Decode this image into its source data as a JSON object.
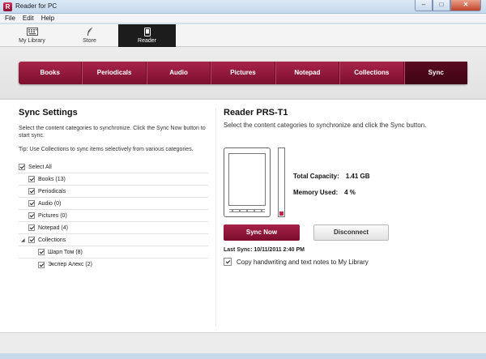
{
  "window": {
    "title": "Reader for PC",
    "icon_letter": "R",
    "controls": [
      "min",
      "max",
      "close"
    ]
  },
  "menu": [
    "File",
    "Edit",
    "Help"
  ],
  "top_tabs": [
    {
      "label": "My Library",
      "icon": "library-keyboard-icon"
    },
    {
      "label": "Store",
      "icon": "store-feather-icon"
    },
    {
      "label": "Reader",
      "icon": "reader-device-icon",
      "active": true
    }
  ],
  "categories": [
    {
      "label": "Books"
    },
    {
      "label": "Periodicals"
    },
    {
      "label": "Audio"
    },
    {
      "label": "Pictures"
    },
    {
      "label": "Notepad"
    },
    {
      "label": "Collections"
    },
    {
      "label": "Sync",
      "active": true
    }
  ],
  "sync_settings": {
    "title": "Sync Settings",
    "description": "Select the content categories to synchronize. Click the Sync Now button to start sync.",
    "tip": "Tip: Use Collections to sync items selectively from various categories.",
    "items": [
      {
        "label": "Select All",
        "checked": true,
        "indent": 0
      },
      {
        "label": "Books (13)",
        "checked": true,
        "indent": 1
      },
      {
        "label": "Periodicals",
        "checked": true,
        "indent": 1
      },
      {
        "label": "Audio (0)",
        "checked": true,
        "indent": 1
      },
      {
        "label": "Pictures (0)",
        "checked": true,
        "indent": 1
      },
      {
        "label": "Notepad (4)",
        "checked": true,
        "indent": 1
      },
      {
        "label": "Collections",
        "checked": true,
        "indent": 1,
        "expanded": true
      },
      {
        "label": "Шарп Том (8)",
        "checked": true,
        "indent": 2
      },
      {
        "label": "Экспер Алекс (2)",
        "checked": true,
        "indent": 2
      }
    ]
  },
  "device": {
    "name": "Reader PRS-T1",
    "instruction": "Select the content categories to synchronize and click the Sync button.",
    "total_capacity_label": "Total Capacity:",
    "total_capacity_value": "1.41 GB",
    "memory_used_label": "Memory Used:",
    "memory_used_value": "4 %",
    "memory_used_fraction": 0.04,
    "sync_button": "Sync Now",
    "disconnect_button": "Disconnect",
    "last_sync": "Last Sync: 10/11/2011 2:40 PM",
    "copy_option": "Copy handwriting and text notes to My Library",
    "copy_checked": true
  },
  "colors": {
    "accent": "#8f1a3c",
    "active_category": "#4a0719",
    "active_tab": "#1c1c1c"
  }
}
